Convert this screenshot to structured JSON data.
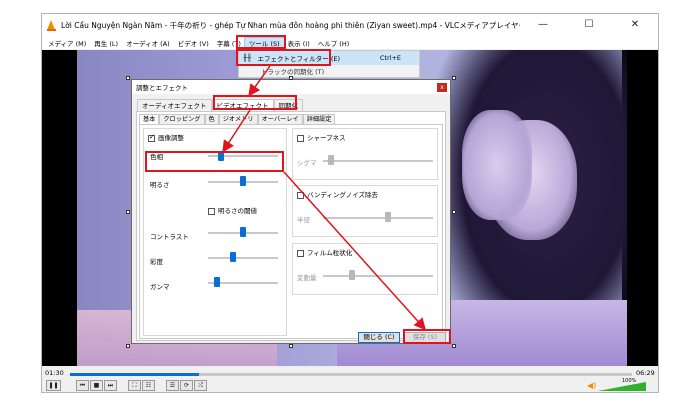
{
  "window": {
    "title": "Lời Cầu Nguyện Ngàn Năm - 千年の祈り - ghép Tự Nhan mùa đôn hoàng phi thiên (Ziyan sweet).mp4 - VLCメディアプレイヤー",
    "minimize": "—",
    "maximize": "☐",
    "close": "✕"
  },
  "menubar": [
    "メディア (M)",
    "再生 (L)",
    "オーディオ (A)",
    "ビデオ (V)",
    "字幕 (T)",
    "ツール (S)",
    "表示 (I)",
    "ヘルプ (H)"
  ],
  "dropdown": {
    "item1_label": "エフェクトとフィルター (E)",
    "item1_shortcut": "Ctrl+E",
    "item2_label": "トラックの同期化 (T)"
  },
  "dialog": {
    "title": "調整とエフェクト",
    "close": "x",
    "tabs": [
      "オーディオエフェクト",
      "ビデオエフェクト",
      "同期化"
    ],
    "subtabs": [
      "基本",
      "クロッピング",
      "色",
      "ジオメトリ",
      "オーバーレイ",
      "詳細設定"
    ],
    "image_adjust": "画像調整",
    "hue": "色相",
    "brightness": "明るさ",
    "brightness_threshold": "明るさの閾値",
    "contrast": "コントラスト",
    "saturation": "彩度",
    "gamma": "ガンマ",
    "sharpen": "シャープネス",
    "sigma": "シグマ",
    "banding": "バンディングノイズ除去",
    "radius": "半径",
    "film_grain": "フィルム粒状化",
    "variance": "変動量",
    "close_btn": "閉じる (C)",
    "save_btn": "保存 (S)",
    "sliders": {
      "hue": 0.15,
      "brightness": 0.5,
      "contrast": 0.5,
      "saturation": 0.35,
      "gamma": 0.1,
      "sigma": 0.05,
      "radius": 0.6,
      "variance": 0.25
    }
  },
  "player": {
    "elapsed": "01:30",
    "total": "06:29",
    "progress": 0.23,
    "volume": "100%",
    "buttons": [
      "❚❚",
      "⏮",
      "■",
      "⏭",
      "⛶",
      "☷",
      "☰",
      "⟳",
      "⤮"
    ]
  },
  "colors": {
    "accent": "#0a6fd1",
    "annotation": "#e0141e",
    "vlc_orange": "#f08c00"
  }
}
